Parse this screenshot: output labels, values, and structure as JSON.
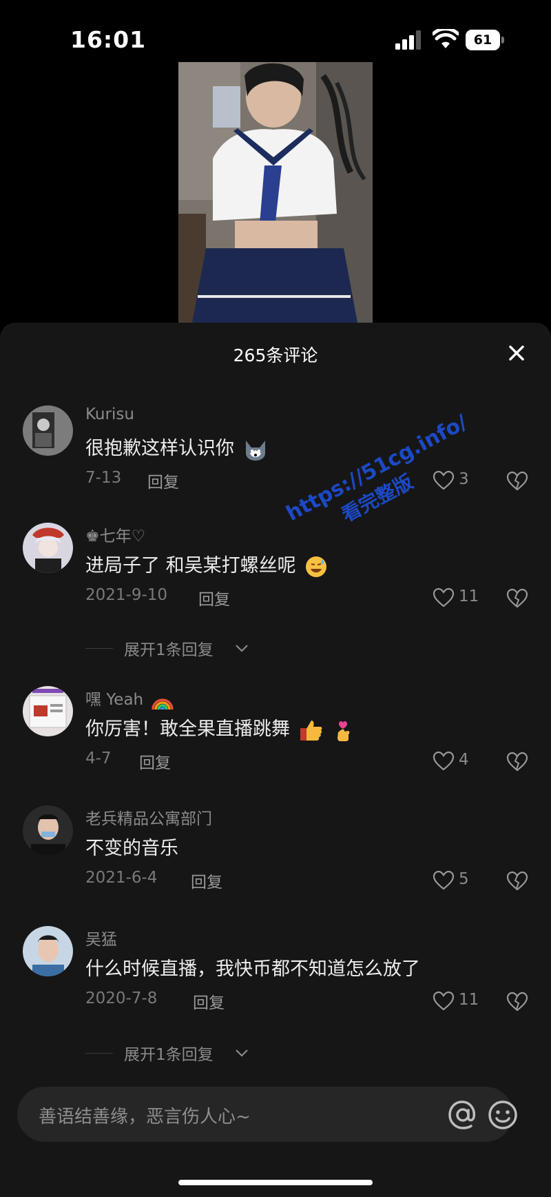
{
  "status_bar": {
    "time": "16:01",
    "battery": "61"
  },
  "comments_sheet": {
    "title": "265条评论",
    "reply_label": "回复",
    "comments": [
      {
        "username": "Kurisu",
        "text": "很抱歉这样认识你",
        "date": "7-13",
        "likes": "3"
      },
      {
        "username": "♚七年♡",
        "text": "进局子了 和吴某打螺丝呢",
        "date": "2021-9-10",
        "likes": "11",
        "expand_label": "展开1条回复"
      },
      {
        "username": "嘿 Yeah",
        "text": "你厉害！敢全果直播跳舞",
        "date": "4-7",
        "likes": "4"
      },
      {
        "username": "老兵精品公寓部门",
        "text": "不变的音乐",
        "date": "2021-6-4",
        "likes": "5"
      },
      {
        "username": "吴猛",
        "text": "什么时候直播，我快币都不知道怎么放了",
        "date": "2020-7-8",
        "likes": "11",
        "expand_label": "展开1条回复"
      }
    ]
  },
  "watermark": {
    "line1": "https://51cg.info/",
    "line2": "看完整版"
  },
  "input": {
    "placeholder": "善语结善缘，恶言伤人心~"
  },
  "colors": {
    "sheet_bg": "#161616",
    "input_bg": "#262626",
    "watermark": "#1d4fd8"
  },
  "icons": [
    "signal-icon",
    "wifi-icon",
    "battery-icon",
    "close-icon",
    "heart-icon",
    "broken-heart-icon",
    "chevron-down-icon",
    "at-icon",
    "emoji-icon"
  ]
}
